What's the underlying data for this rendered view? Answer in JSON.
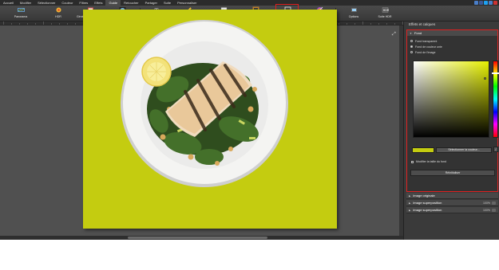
{
  "menu": [
    {
      "label": "Accueil",
      "active": false
    },
    {
      "label": "Modifier",
      "active": false
    },
    {
      "label": "Sélectionner",
      "active": false
    },
    {
      "label": "Couleur",
      "active": false
    },
    {
      "label": "Filtres",
      "active": false
    },
    {
      "label": "Effets",
      "active": false
    },
    {
      "label": "Guide",
      "active": true
    },
    {
      "label": "Retoucher",
      "active": false
    },
    {
      "label": "Partager",
      "active": false
    },
    {
      "label": "Suite",
      "active": false
    },
    {
      "label": "Personnaliser",
      "active": false
    }
  ],
  "window_icons": [
    "#4a7ec8",
    "#3b5998",
    "#1da1f2",
    "#4a7ec8",
    "#cc3333"
  ],
  "toolbar": {
    "panorama": "Panorama",
    "hdr": "HDR",
    "card_generator": "Générateur de cartes",
    "vignette": "Vignettes",
    "text": "Texte",
    "draw": "Outil de dessin",
    "image": "Image",
    "border": "Bordure",
    "background": "Fond",
    "remove_color": "Supprimer couleur",
    "options": "Options",
    "suite": "Suite HDR"
  },
  "panel": {
    "title": "Effets et calques",
    "section": "Fond",
    "options": [
      "Fond transparent",
      "Fond de couleur unie",
      "Fond de l'image"
    ],
    "selected_option_index": 1,
    "select_color_label": "Sélectionner la couleur...",
    "resize_checkbox": "Modifier la taille du fond",
    "reset_label": "Réinitialiser",
    "current_color": "#c4cc10"
  },
  "layers": [
    {
      "label": "Image originale",
      "opacity": ""
    },
    {
      "label": "Image superposition",
      "opacity": "100%"
    },
    {
      "label": "Image superposition",
      "opacity": "100%"
    }
  ],
  "canvas": {
    "background_color": "#c4cc10"
  }
}
